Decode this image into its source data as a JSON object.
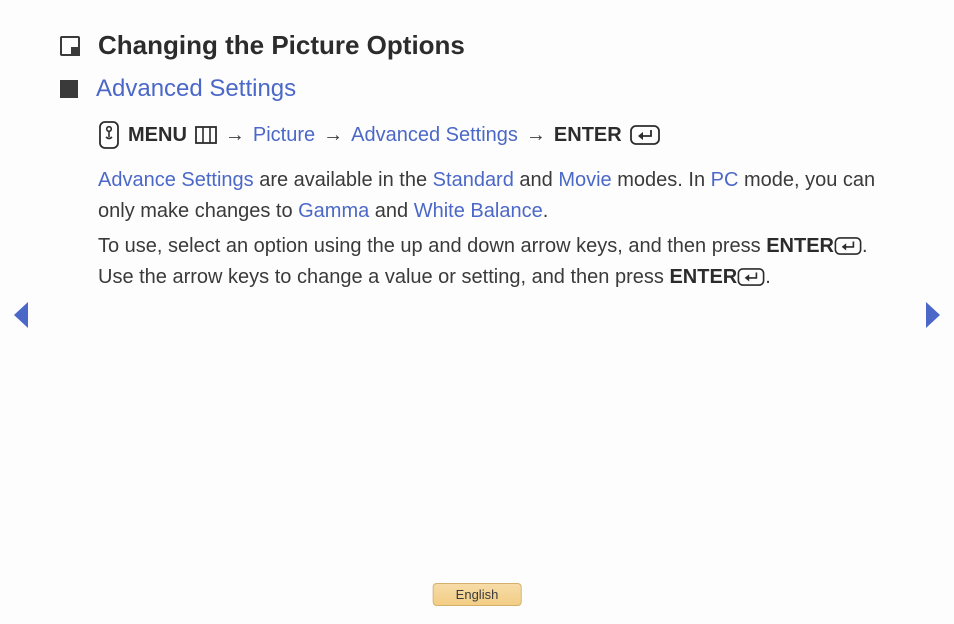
{
  "heading": "Changing the Picture Options",
  "subheading": "Advanced Settings",
  "nav": {
    "menu_label": "MENU",
    "arrow": "→",
    "picture": "Picture",
    "advanced": "Advanced Settings",
    "enter_label": "ENTER"
  },
  "para1": {
    "advance_settings": "Advance Settings",
    "t1": " are available in the ",
    "standard": "Standard",
    "t2": " and ",
    "movie": "Movie",
    "t3": " modes. In ",
    "pc": "PC",
    "t4": " mode, you can only make changes to ",
    "gamma": "Gamma",
    "t5": " and ",
    "white_balance": "White Balance",
    "t6": "."
  },
  "para2": {
    "t1": "To use, select an option using the up and down arrow keys, and then press ",
    "enter1": "ENTER",
    "t2": ". Use the arrow keys to change a value or setting, and then press ",
    "enter2": "ENTER",
    "t3": "."
  },
  "footer": {
    "language": "English"
  }
}
